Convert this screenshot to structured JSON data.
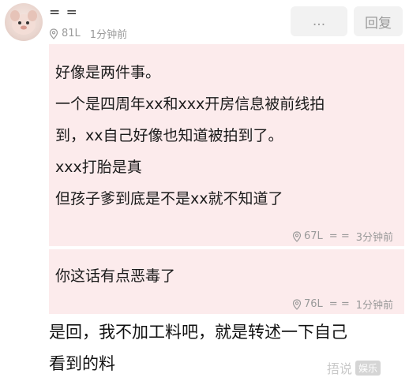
{
  "post": {
    "username": "= =",
    "floor": "81L",
    "time": "1分钟前"
  },
  "actions": {
    "more_label": "...",
    "reply_label": "回复"
  },
  "quotes": [
    {
      "lines": [
        "好像是两件事。",
        "一个是四周年xx和xxx开房信息被前线拍",
        "到，xx自己好像也知道被拍到了。",
        "xxx打胎是真",
        "但孩子爹到底是不是xx就不知道了"
      ],
      "floor": "67L",
      "user": "= =",
      "time": "3分钟前"
    },
    {
      "lines": [
        "你这话有点恶毒了"
      ],
      "floor": "76L",
      "user": "= =",
      "time": "1分钟前"
    }
  ],
  "main": {
    "lines": [
      "是回，我不加工料吧，就是转述一下自己",
      "看到的料"
    ]
  },
  "watermark": {
    "text": "捂说",
    "badge": "娱乐"
  }
}
